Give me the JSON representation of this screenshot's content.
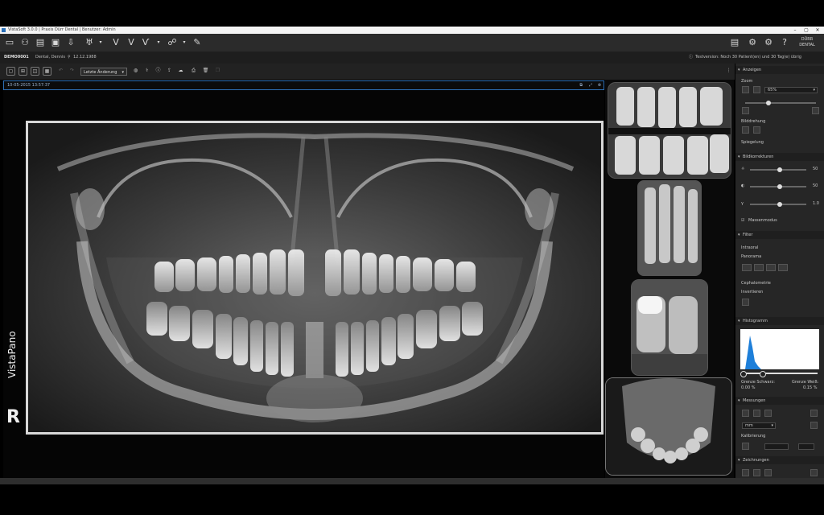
{
  "window": {
    "title": "VistaSoft 3.0.0 | Praxis Dürr Dental | Benutzer: Admin",
    "minimize": "–",
    "maximize": "▢",
    "close": "✕"
  },
  "patient": {
    "id": "DEMO0001",
    "name": "Dental, Dennis",
    "dob": "12.12.1988",
    "trial_notice": "Testversion: Noch 30 Patient(en) und 30 Tag(e) übrig"
  },
  "image_toolbar": {
    "dropdown_value": "Letzte Änderung"
  },
  "viewer": {
    "timestamp": "10-05-2015 13:57:37",
    "modality_label": "VistaPano",
    "side_marker": "R"
  },
  "panel": {
    "anzeigen": "Anzeigen",
    "zoom_label": "Zoom",
    "zoom_value": "65%",
    "bilddrehung": "Bilddrehung",
    "spiegelung": "Spiegelung",
    "bildkorrekturen": "Bildkorrekturen",
    "brightness_value": "50",
    "contrast_value": "50",
    "gamma_value": "1.0",
    "masse_modus": "Massenmodus",
    "filter": "Filter",
    "intraoral": "Intraoral",
    "panorama": "Panorama",
    "cephalometrie": "Cephalometrie",
    "invertieren": "Invertieren",
    "histogramm": "Histogramm",
    "grenze_schwarz": "Grenze Schwarz:",
    "grenze_schwarz_val": "0.00 %",
    "grenze_weiss": "Grenze Weiß:",
    "grenze_weiss_val": "0.15 %",
    "messungen": "Messungen",
    "unit": "mm",
    "kalibrierung": "Kalibrierung",
    "zeichnungen": "Zeichnungen"
  }
}
